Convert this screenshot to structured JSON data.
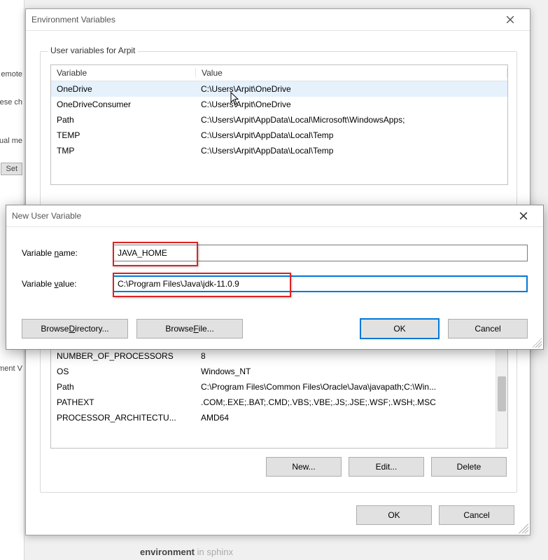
{
  "bg": {
    "l1": "emote",
    "l2": "ese ch",
    "l3": "ual me",
    "set_btn": "Set",
    "l4": "ment V"
  },
  "env": {
    "title": "Environment Variables",
    "user_group": "User variables for Arpit",
    "col_var": "Variable",
    "col_val": "Value",
    "user_rows": [
      {
        "var": "OneDrive",
        "val": "C:\\Users\\Arpit\\OneDrive"
      },
      {
        "var": "OneDriveConsumer",
        "val": "C:\\Users\\Arpit\\OneDrive"
      },
      {
        "var": "Path",
        "val": "C:\\Users\\Arpit\\AppData\\Local\\Microsoft\\WindowsApps;"
      },
      {
        "var": "TEMP",
        "val": "C:\\Users\\Arpit\\AppData\\Local\\Temp"
      },
      {
        "var": "TMP",
        "val": "C:\\Users\\Arpit\\AppData\\Local\\Temp"
      }
    ],
    "sys_rows": [
      {
        "var": "NUMBER_OF_PROCESSORS",
        "val": "8"
      },
      {
        "var": "OS",
        "val": "Windows_NT"
      },
      {
        "var": "Path",
        "val": "C:\\Program Files\\Common Files\\Oracle\\Java\\javapath;C:\\Win..."
      },
      {
        "var": "PATHEXT",
        "val": ".COM;.EXE;.BAT;.CMD;.VBS;.VBE;.JS;.JSE;.WSF;.WSH;.MSC"
      },
      {
        "var": "PROCESSOR_ARCHITECTU...",
        "val": "AMD64"
      }
    ],
    "btn_new": "New...",
    "btn_edit": "Edit...",
    "btn_del": "Delete",
    "btn_ok": "OK",
    "btn_cancel": "Cancel"
  },
  "nuv": {
    "title": "New User Variable",
    "lbl_name_pre": "Variable ",
    "lbl_name_u": "n",
    "lbl_name_post": "ame:",
    "lbl_value_pre": "Variable ",
    "lbl_value_u": "v",
    "lbl_value_post": "alue:",
    "name_val": "JAVA_HOME",
    "value_val": "C:\\Program Files\\Java\\jdk-11.0.9",
    "btn_browse_dir_pre": "Browse ",
    "btn_browse_dir_u": "D",
    "btn_browse_dir_post": "irectory...",
    "btn_browse_file_pre": "Browse ",
    "btn_browse_file_u": "F",
    "btn_browse_file_post": "ile...",
    "btn_ok": "OK",
    "btn_cancel": "Cancel"
  },
  "footer": {
    "word": "environment",
    "tail": "in sphinx"
  }
}
